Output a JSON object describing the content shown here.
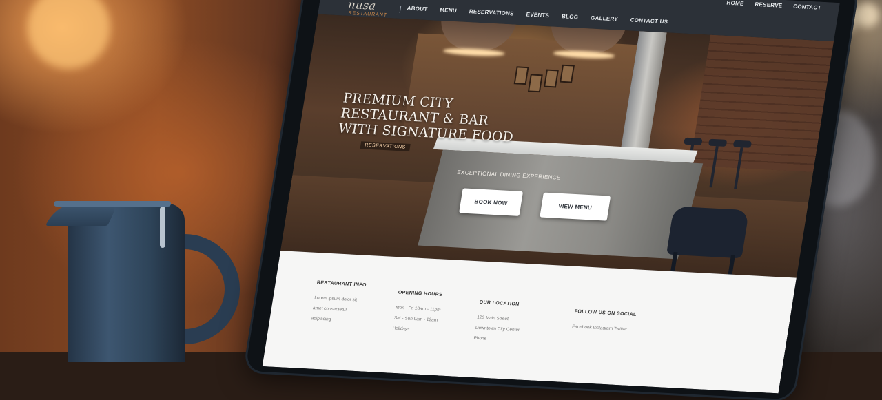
{
  "site": {
    "logo": "nusa",
    "logo_sub": "RESTAURANT"
  },
  "nav": {
    "top_links": [
      "HOME",
      "RESERVE",
      "CONTACT"
    ],
    "items": [
      "ABOUT",
      "MENU",
      "RESERVATIONS",
      "EVENTS",
      "BLOG",
      "GALLERY",
      "CONTACT US"
    ]
  },
  "hero": {
    "title_line1": "PREMIUM CITY",
    "title_line2": "RESTAURANT & BAR",
    "title_line3": "WITH SIGNATURE FOOD",
    "badge": "RESERVATIONS",
    "subtitle": "EXCEPTIONAL DINING EXPERIENCE",
    "button_primary": "BOOK NOW",
    "button_secondary": "VIEW MENU"
  },
  "footer": {
    "columns": [
      {
        "heading": "RESTAURANT INFO",
        "lines": [
          "Lorem ipsum dolor sit",
          "amet consectetur",
          "adipiscing"
        ]
      },
      {
        "heading": "OPENING HOURS",
        "lines": [
          "Mon - Fri 10am - 11pm",
          "Sat - Sun 9am - 12am",
          "Holidays"
        ]
      },
      {
        "heading": "OUR LOCATION",
        "lines": [
          "123 Main Street",
          "Downtown City Center",
          "Phone"
        ]
      },
      {
        "heading": "FOLLOW US ON SOCIAL",
        "lines": [
          "Facebook Instagram Twitter"
        ]
      }
    ]
  },
  "colors": {
    "nav_bg": "#2c3138",
    "accent": "#cf8a4a",
    "button_bg": "#ffffff",
    "footer_bg": "#f6f6f5"
  }
}
